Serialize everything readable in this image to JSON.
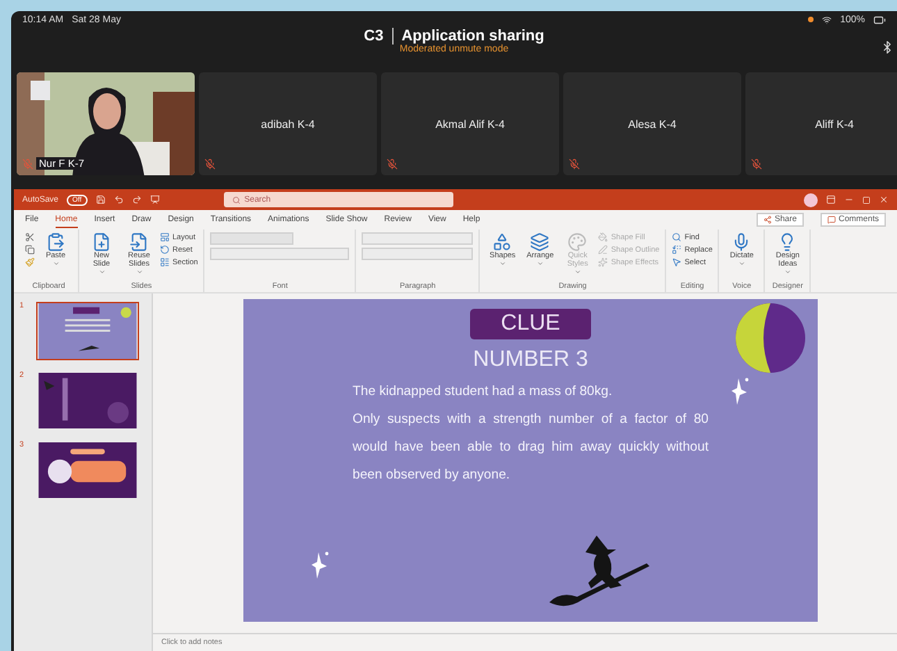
{
  "status_bar": {
    "time": "10:14 AM",
    "date": "Sat 28 May",
    "battery": "100%"
  },
  "meeting": {
    "channel": "C3",
    "title": "Application sharing",
    "mode": "Moderated unmute mode"
  },
  "participants": [
    {
      "name": "Nur F K-7",
      "kind": "video",
      "muted": true
    },
    {
      "name": "adibah K-4",
      "kind": "tile",
      "muted": true
    },
    {
      "name": "Akmal Alif K-4",
      "kind": "tile",
      "muted": true
    },
    {
      "name": "Alesa K-4",
      "kind": "tile",
      "muted": true
    },
    {
      "name": "Aliff K-4",
      "kind": "tile",
      "muted": true
    }
  ],
  "powerpoint": {
    "autosave": {
      "label": "AutoSave",
      "state": "Off",
      "on": false
    },
    "search": {
      "placeholder": "Search"
    },
    "tabs": [
      {
        "label": "File",
        "selected": false
      },
      {
        "label": "Home",
        "selected": true
      },
      {
        "label": "Insert",
        "selected": false
      },
      {
        "label": "Draw",
        "selected": false
      },
      {
        "label": "Design",
        "selected": false
      },
      {
        "label": "Transitions",
        "selected": false
      },
      {
        "label": "Animations",
        "selected": false
      },
      {
        "label": "Slide Show",
        "selected": false
      },
      {
        "label": "Review",
        "selected": false
      },
      {
        "label": "View",
        "selected": false
      },
      {
        "label": "Help",
        "selected": false
      }
    ],
    "share": "Share",
    "comments": "Comments",
    "groups": [
      {
        "label": "Clipboard",
        "buttons": [
          {
            "label": "Paste",
            "kind": "large"
          }
        ]
      },
      {
        "label": "Slides",
        "buttons": [
          {
            "label": "New Slide",
            "kind": "large"
          },
          {
            "label": "Reuse Slides",
            "kind": "large"
          },
          {
            "label": "Layout",
            "kind": "small"
          },
          {
            "label": "Reset",
            "kind": "small"
          },
          {
            "label": "Section",
            "kind": "small"
          }
        ]
      },
      {
        "label": "Font",
        "kind": "font"
      },
      {
        "label": "Paragraph",
        "kind": "paragraph"
      },
      {
        "label": "Drawing",
        "buttons": [
          {
            "label": "Shapes",
            "kind": "large"
          },
          {
            "label": "Arrange",
            "kind": "large"
          },
          {
            "label": "Quick Styles",
            "kind": "large",
            "disabled": true
          },
          {
            "label": "Shape Fill",
            "kind": "small",
            "disabled": true
          },
          {
            "label": "Shape Outline",
            "kind": "small",
            "disabled": true
          },
          {
            "label": "Shape Effects",
            "kind": "small",
            "disabled": true
          }
        ]
      },
      {
        "label": "Editing",
        "buttons": [
          {
            "label": "Find",
            "kind": "small"
          },
          {
            "label": "Replace",
            "kind": "small"
          },
          {
            "label": "Select",
            "kind": "small"
          }
        ]
      },
      {
        "label": "Voice",
        "buttons": [
          {
            "label": "Dictate",
            "kind": "large"
          }
        ]
      },
      {
        "label": "Designer",
        "buttons": [
          {
            "label": "Design Ideas",
            "kind": "large"
          }
        ]
      }
    ],
    "thumbnails": [
      {
        "number": "1",
        "selected": true,
        "kind": "clue"
      },
      {
        "number": "2",
        "selected": false,
        "kind": "list"
      },
      {
        "number": "3",
        "selected": false,
        "kind": "banner"
      }
    ],
    "slide": {
      "badge": "CLUE",
      "heading": "NUMBER 3",
      "lead": "The kidnapped student had a mass of 80kg.",
      "body": "Only suspects with a strength number of a factor of 80 would have been able to drag him away quickly without been observed by anyone."
    },
    "notes_placeholder": "Click to add notes"
  }
}
